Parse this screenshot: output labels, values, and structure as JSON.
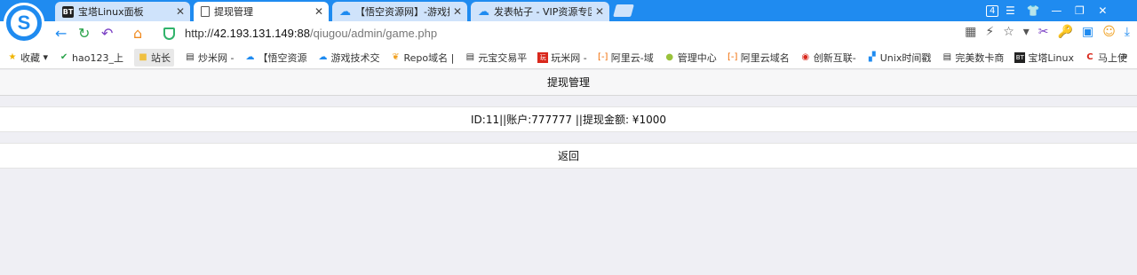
{
  "browser": {
    "tabs": [
      {
        "label": "宝塔Linux面板",
        "icon": "bt-icon"
      },
      {
        "label": "提现管理",
        "icon": "document-icon"
      },
      {
        "label": "【悟空资源网】-游戏技",
        "icon": "cloud-icon"
      },
      {
        "label": "发表帖子 - VIP资源专区",
        "icon": "cloud-icon"
      }
    ],
    "tab_count": "4",
    "url_scheme": "http://",
    "url_host": "42.193.131.149:88",
    "url_path": "/qiugou/admin/game.php",
    "bookmarks": [
      {
        "label": "收藏",
        "icon": "star-icon"
      },
      {
        "label": "hao123_上",
        "icon": "hao123-icon"
      },
      {
        "label": "站长",
        "icon": "folder-icon"
      },
      {
        "label": "炒米网 -",
        "icon": "document-icon"
      },
      {
        "label": "【悟空资源",
        "icon": "cloud-icon"
      },
      {
        "label": "游戏技术交",
        "icon": "cloud-icon"
      },
      {
        "label": "Repo域名 |",
        "icon": "leaf-icon"
      },
      {
        "label": "元宝交易平",
        "icon": "document-icon"
      },
      {
        "label": "玩米网 -",
        "icon": "wanmi-icon"
      },
      {
        "label": "阿里云-域",
        "icon": "aliyun-icon"
      },
      {
        "label": "管理中心",
        "icon": "manage-icon"
      },
      {
        "label": "阿里云域名",
        "icon": "aliyun-icon"
      },
      {
        "label": "创新互联-",
        "icon": "chuangxin-icon"
      },
      {
        "label": "Unix时间戳",
        "icon": "unix-icon"
      },
      {
        "label": "完美数卡商",
        "icon": "document-icon"
      },
      {
        "label": "宝塔Linux",
        "icon": "bt-icon"
      },
      {
        "label": "马上使",
        "icon": "c-icon"
      }
    ],
    "accent_color": "#1f8bf0"
  },
  "page": {
    "title": "提现管理",
    "record": "ID:11||账户:777777 ||提现金额: ¥1000",
    "back_label": "返回"
  }
}
